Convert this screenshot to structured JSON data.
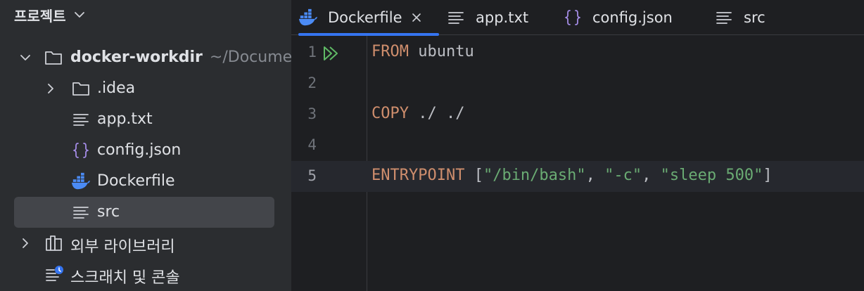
{
  "sidebar": {
    "project_header": "프로젝트",
    "items": [
      {
        "label": "docker-workdir",
        "hint": "~/Documents"
      },
      {
        "label": ".idea"
      },
      {
        "label": "app.txt"
      },
      {
        "label": "config.json"
      },
      {
        "label": "Dockerfile"
      },
      {
        "label": "src"
      },
      {
        "label": "외부 라이브러리"
      },
      {
        "label": "스크래치 및 콘솔"
      }
    ]
  },
  "tabs": [
    {
      "label": "Dockerfile",
      "active": true
    },
    {
      "label": "app.txt"
    },
    {
      "label": "config.json"
    },
    {
      "label": "src"
    }
  ],
  "editor": {
    "lines": [
      {
        "num": "1",
        "kw": "FROM",
        "rest": " ubuntu"
      },
      {
        "num": "2"
      },
      {
        "num": "3",
        "kw": "COPY",
        "rest": " ./ ./"
      },
      {
        "num": "4"
      },
      {
        "num": "5",
        "kw": "ENTRYPOINT",
        "p1": " [",
        "s1": "\"/bin/bash\"",
        "c1": ", ",
        "s2": "\"-c\"",
        "c2": ", ",
        "s3": "\"sleep 500\"",
        "p2": "]"
      }
    ]
  },
  "colors": {
    "accent": "#3574f0",
    "docker_blue": "#4b8bf5",
    "json_purple": "#a48ce6",
    "keyword": "#cf8e6d",
    "string": "#6aab73"
  }
}
